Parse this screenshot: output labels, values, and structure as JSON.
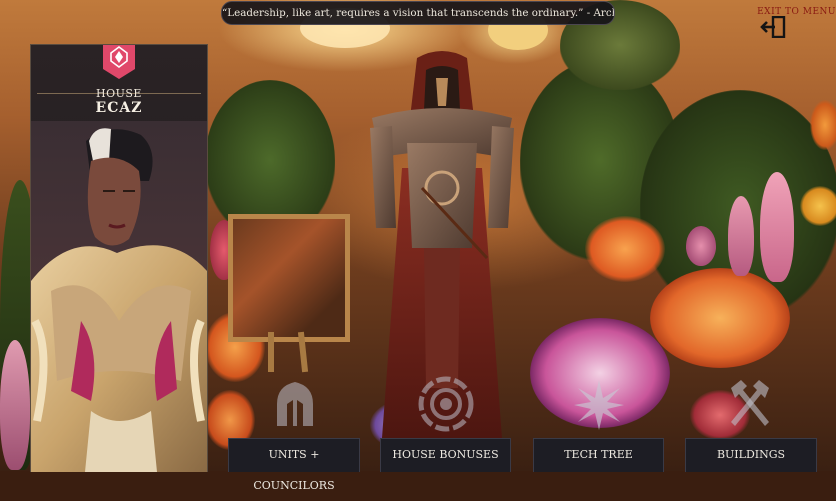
{
  "quote": {
    "text": "“Leadership, like art, requires a vision that transcends the ordinary.” - Archduke Armand Ecaz"
  },
  "exit": {
    "label": "EXIT TO MENU",
    "icon": "exit-door-icon"
  },
  "house": {
    "label_small": "HOUSE",
    "label_big": "ECAZ",
    "emblem_icon": "house-ecaz-crest-icon"
  },
  "tabs": [
    {
      "label": "UNITS + COUNCILORS",
      "icon": "helmet-icon"
    },
    {
      "label": "HOUSE BONUSES",
      "icon": "target-crest-icon"
    },
    {
      "label": "TECH TREE",
      "icon": "starburst-icon"
    },
    {
      "label": "BUILDINGS",
      "icon": "crossed-hammers-icon"
    }
  ],
  "colors": {
    "accent": "#e0486a",
    "panel_bg": "#221c1f",
    "tab_bg": "#1d1d24",
    "quote_bg": "#161418"
  }
}
